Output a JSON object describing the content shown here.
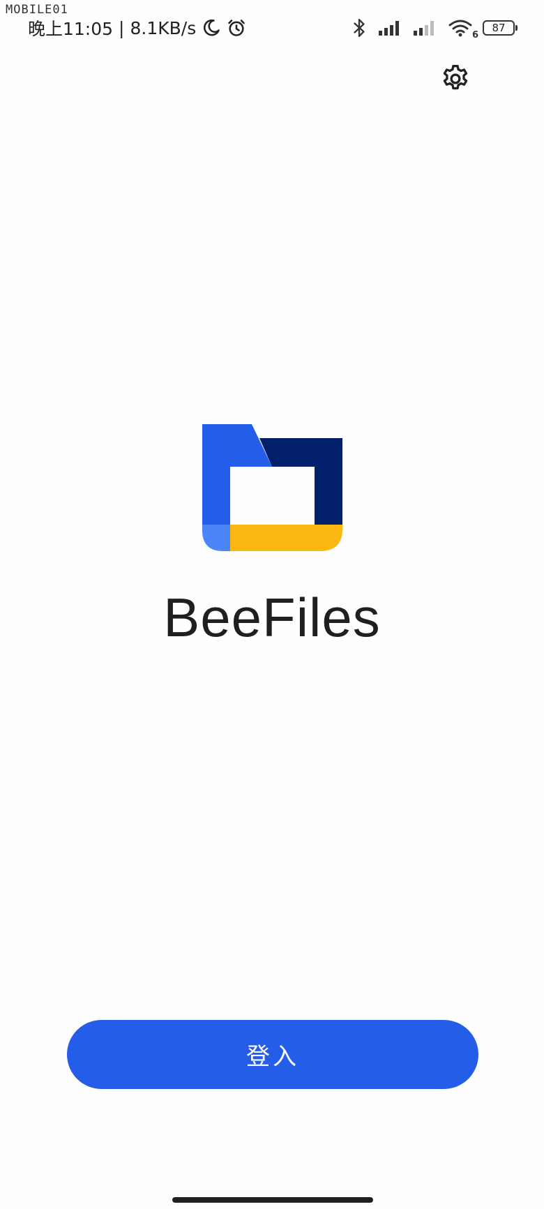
{
  "watermark": "MOBILE01",
  "status_bar": {
    "time": "晚上11:05",
    "separator": "|",
    "network_speed": "8.1KB/s",
    "left_icons": [
      "moon-icon",
      "alarm-icon"
    ],
    "right_icons": [
      "bluetooth-icon",
      "signal-icon",
      "signal-icon",
      "wifi-icon"
    ],
    "wifi_badge": "6",
    "battery": "87"
  },
  "settings": {
    "icon": "gear-icon"
  },
  "logo": {
    "icon": "folder-logo-icon",
    "colors": {
      "blue": "#245de8",
      "light_blue": "#4a86f7",
      "navy": "#02206b",
      "yellow": "#fcb713"
    }
  },
  "app_title": "BeeFiles",
  "login_button": {
    "label": "登入",
    "color": "#245de8"
  }
}
